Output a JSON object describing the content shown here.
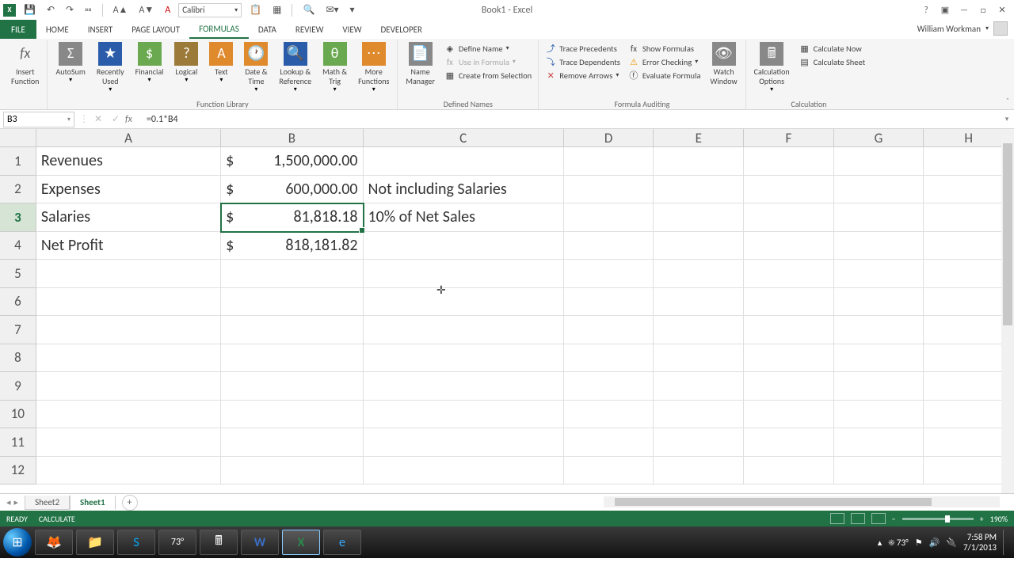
{
  "title": "Book1 - Excel",
  "user": "William Workman",
  "qat": {
    "font": "Calibri"
  },
  "tabs": [
    "HOME",
    "INSERT",
    "PAGE LAYOUT",
    "FORMULAS",
    "DATA",
    "REVIEW",
    "VIEW",
    "DEVELOPER"
  ],
  "activeTab": "FORMULAS",
  "fileTab": "FILE",
  "ribbon": {
    "insertFunction": "Insert\nFunction",
    "funcLib": {
      "autosum": "AutoSum",
      "recent": "Recently\nUsed",
      "financial": "Financial",
      "logical": "Logical",
      "text": "Text",
      "datetime": "Date &\nTime",
      "lookup": "Lookup &\nReference",
      "math": "Math &\nTrig",
      "more": "More\nFunctions",
      "label": "Function Library"
    },
    "names": {
      "manager": "Name\nManager",
      "define": "Define Name",
      "usein": "Use in Formula",
      "create": "Create from Selection",
      "label": "Defined Names"
    },
    "audit": {
      "traceP": "Trace Precedents",
      "traceD": "Trace Dependents",
      "remove": "Remove Arrows",
      "showF": "Show Formulas",
      "errorC": "Error Checking",
      "evalF": "Evaluate Formula",
      "watch": "Watch\nWindow",
      "label": "Formula Auditing"
    },
    "calc": {
      "options": "Calculation\nOptions",
      "now": "Calculate Now",
      "sheet": "Calculate Sheet",
      "label": "Calculation"
    }
  },
  "nameBox": "B3",
  "formula": "=0.1*B4",
  "columns": [
    "A",
    "B",
    "C",
    "D",
    "E",
    "F",
    "G",
    "H"
  ],
  "rowNums": [
    "1",
    "2",
    "3",
    "4",
    "5",
    "6",
    "7",
    "8",
    "9",
    "10",
    "11",
    "12"
  ],
  "activeRow": "3",
  "cells": {
    "A1": "Revenues",
    "A2": "Expenses",
    "A3": "Salaries",
    "A4": "Net Profit",
    "B1": {
      "cur": "$",
      "amt": "1,500,000.00"
    },
    "B2": {
      "cur": "$",
      "amt": "600,000.00"
    },
    "B3": {
      "cur": "$",
      "amt": "81,818.18"
    },
    "B4": {
      "cur": "$",
      "amt": "818,181.82"
    },
    "C2": "Not including Salaries",
    "C3": "10% of Net Sales"
  },
  "sheets": {
    "tabs": [
      "Sheet2",
      "Sheet1"
    ],
    "active": "Sheet1"
  },
  "status": {
    "ready": "READY",
    "calc": "CALCULATE",
    "zoom": "190%"
  },
  "taskbar": {
    "weather": "73°",
    "time": "7:58 PM",
    "date": "7/1/2013"
  }
}
